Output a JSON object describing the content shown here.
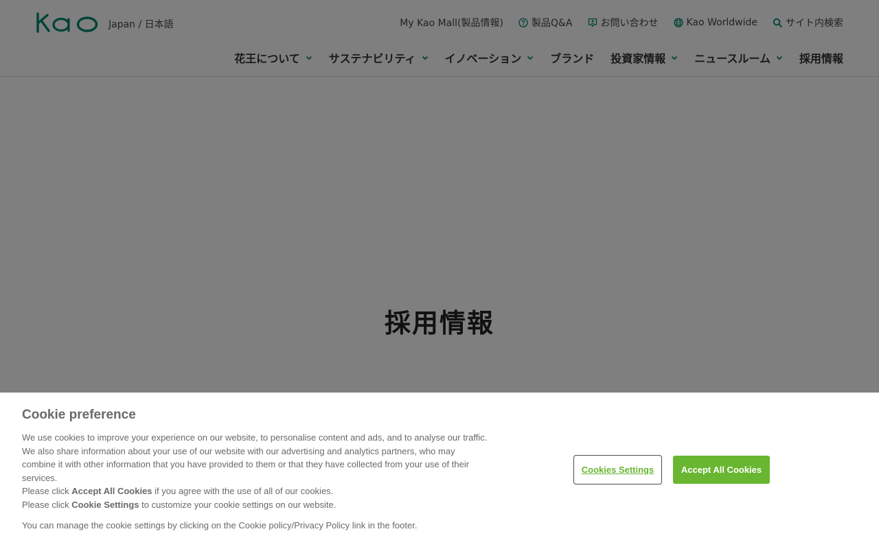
{
  "header": {
    "logo_text": "Kao",
    "region": "Japan / 日本語",
    "utility": [
      {
        "label": "My Kao Mall(製品情報)",
        "icon": ""
      },
      {
        "label": "製品Q&A",
        "icon": "question-circle-icon"
      },
      {
        "label": "お問い合わせ",
        "icon": "contact-person-icon"
      },
      {
        "label": "Kao Worldwide",
        "icon": "globe-icon"
      },
      {
        "label": "サイト内検索",
        "icon": "search-icon"
      }
    ],
    "nav": [
      {
        "label": "花王について",
        "dropdown": true
      },
      {
        "label": "サステナビリティ",
        "dropdown": true
      },
      {
        "label": "イノベーション",
        "dropdown": true
      },
      {
        "label": "ブランド",
        "dropdown": false
      },
      {
        "label": "投資家情報",
        "dropdown": true
      },
      {
        "label": "ニュースルーム",
        "dropdown": true
      },
      {
        "label": "採用情報",
        "dropdown": false
      }
    ]
  },
  "hero": {
    "page_title": "採用情報"
  },
  "cookie": {
    "title": "Cookie preference",
    "body": "We use cookies to improve your experience on our website, to personalise content and ads, and to analyse our traffic. We also share information about your use of our website with our advertising and analytics partners, who may combine it with other information that you have provided to them or that they have collected from your use of their services.",
    "accept_pre": "Please click ",
    "accept_bold": "Accept All Cookies",
    "accept_post": " if you agree with the use of all of our cookies.",
    "settings_pre": "Please click ",
    "settings_bold": "Cookie Settings",
    "settings_post": " to customize your cookie settings on our website.",
    "manage": "You can manage the cookie settings by clicking on the Cookie policy/Privacy Policy link in the footer.",
    "settings_button": "Cookies Settings",
    "accept_button": "Accept All Cookies"
  },
  "colors": {
    "brand_teal": "#00856f",
    "accept_green": "#68b631",
    "overlay": "rgba(0,0,0,0.5)"
  }
}
